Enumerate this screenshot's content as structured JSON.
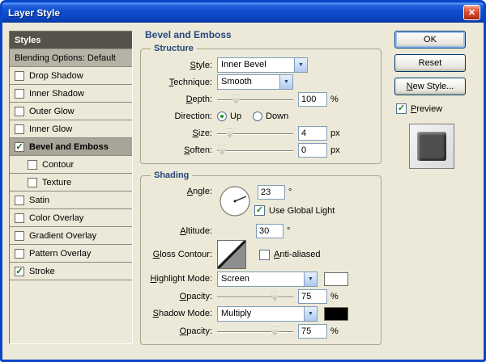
{
  "window": {
    "title": "Layer Style",
    "close_glyph": "✕"
  },
  "sidebar": {
    "header": "Styles",
    "blending_options": "Blending Options: Default",
    "items": [
      {
        "label": "Drop Shadow",
        "checked": false
      },
      {
        "label": "Inner Shadow",
        "checked": false
      },
      {
        "label": "Outer Glow",
        "checked": false
      },
      {
        "label": "Inner Glow",
        "checked": false
      },
      {
        "label": "Bevel and Emboss",
        "checked": true
      },
      {
        "label": "Contour",
        "checked": false
      },
      {
        "label": "Texture",
        "checked": false
      },
      {
        "label": "Satin",
        "checked": false
      },
      {
        "label": "Color Overlay",
        "checked": false
      },
      {
        "label": "Gradient Overlay",
        "checked": false
      },
      {
        "label": "Pattern Overlay",
        "checked": false
      },
      {
        "label": "Stroke",
        "checked": true
      }
    ]
  },
  "panel": {
    "title": "Bevel and Emboss",
    "structure": {
      "title": "Structure",
      "style": {
        "label": "Style:",
        "value": "Inner Bevel"
      },
      "technique": {
        "label": "Technique:",
        "value": "Smooth"
      },
      "depth": {
        "label": "Depth:",
        "value": "100",
        "unit": "%"
      },
      "direction": {
        "label": "Direction:",
        "up": "Up",
        "down": "Down",
        "selected": "Up"
      },
      "size": {
        "label": "Size:",
        "value": "4",
        "unit": "px"
      },
      "soften": {
        "label": "Soften:",
        "value": "0",
        "unit": "px"
      }
    },
    "shading": {
      "title": "Shading",
      "angle": {
        "label": "Angle:",
        "value": "23",
        "unit": "°"
      },
      "use_global_light": {
        "label": "Use Global Light",
        "checked": true
      },
      "altitude": {
        "label": "Altitude:",
        "value": "30",
        "unit": "°"
      },
      "gloss_contour": {
        "label": "Gloss Contour:"
      },
      "anti_aliased": {
        "label": "Anti-aliased",
        "checked": false
      },
      "highlight_mode": {
        "label": "Highlight Mode:",
        "value": "Screen",
        "swatch": "#FFFFFF"
      },
      "highlight_opacity": {
        "label": "Opacity:",
        "value": "75",
        "unit": "%"
      },
      "shadow_mode": {
        "label": "Shadow Mode:",
        "value": "Multiply",
        "swatch": "#000000"
      },
      "shadow_opacity": {
        "label": "Opacity:",
        "value": "75",
        "unit": "%"
      }
    }
  },
  "actions": {
    "ok": "OK",
    "reset": "Reset",
    "new_style": "New Style...",
    "preview": "Preview"
  },
  "colors": {
    "titlebar_blue": "#0A46C8",
    "dialog_bg": "#ECE9D8",
    "group_title": "#26477C",
    "selection_gray": "#A8A498"
  }
}
